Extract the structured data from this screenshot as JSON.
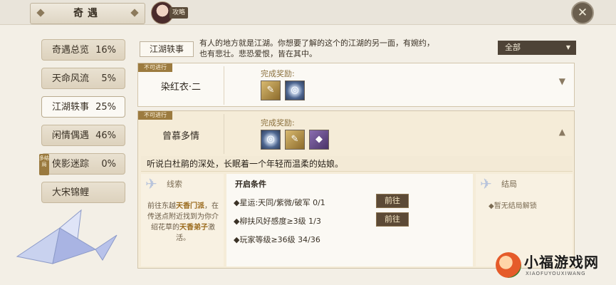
{
  "header": {
    "title": "奇遇",
    "guide_label": "攻略",
    "close_icon": "close-icon"
  },
  "sidebar": {
    "items": [
      {
        "label": "奇遇总览",
        "pct": "16%"
      },
      {
        "label": "天命风流",
        "pct": "5%"
      },
      {
        "label": "江湖轶事",
        "pct": "25%"
      },
      {
        "label": "闲情偶遇",
        "pct": "46%"
      },
      {
        "label": "侠影迷踪",
        "pct": "0%",
        "tag": "多结局"
      },
      {
        "label": "大宋锦鲤",
        "pct": ""
      }
    ]
  },
  "intro": {
    "label": "江湖轶事",
    "text": "有人的地方就是江湖。你想要了解的这个的江湖的另一面，有婉约，也有悲壮。悲恐爱恨，皆在其中。",
    "filter": "全部"
  },
  "cards": [
    {
      "status": "不可进行",
      "name": "染红衣·二",
      "reward_label": "完成奖励:",
      "rewards": [
        "gold-scroll-icon",
        "blue-orb-icon"
      ],
      "toggle": "▼"
    },
    {
      "status": "不可进行",
      "name": "曾慕多情",
      "reward_label": "完成奖励:",
      "rewards": [
        "blue-orb-icon",
        "gold-scroll-icon",
        "purple-book-icon"
      ],
      "toggle": "▲",
      "quote": "听说白杜鹃的深处，长眠着一个年轻而温柔的姑娘。",
      "clue": {
        "title": "线索",
        "text_before": "前往东越",
        "text_bold1": "天香门派",
        "text_mid": "，在传送点附近找到为你介绍花草的",
        "text_bold2": "天香弟子",
        "text_after": "激活。"
      },
      "conditions": {
        "title": "开启条件",
        "rows": [
          {
            "text": "◆星运:天同/紫微/破军  0/1",
            "button": "前往"
          },
          {
            "text": "◆柳扶风好感度≥3级  1/3",
            "button": "前往"
          },
          {
            "text": "◆玩家等级≥36级  34/36",
            "button": ""
          }
        ]
      },
      "ending": {
        "title": "结局",
        "text": "◆暂无结局解锁"
      }
    }
  ],
  "watermark": {
    "text": "小福游戏网",
    "sub": "XIAOFUYOUXIWANG"
  }
}
